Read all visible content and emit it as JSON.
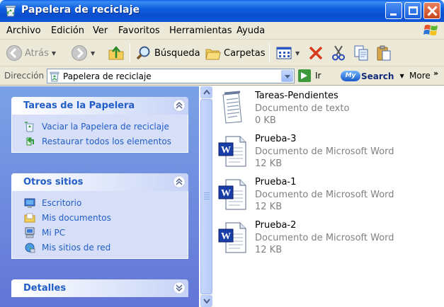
{
  "window": {
    "title": "Papelera de reciclaje",
    "title_icon": "recycle-bin-icon"
  },
  "menu": {
    "items": [
      "Archivo",
      "Edición",
      "Ver",
      "Favoritos",
      "Herramientas",
      "Ayuda"
    ]
  },
  "toolbar": {
    "back_label": "Atrás",
    "search_label": "Búsqueda",
    "folders_label": "Carpetas"
  },
  "address": {
    "label": "Dirección",
    "value": "Papelera de reciclaje",
    "go_label": "Ir",
    "mysearch_logo": "My",
    "mysearch_label": "Search",
    "more_label": "More",
    "more_chevron": "»"
  },
  "taskpane": {
    "panels": [
      {
        "title": "Tareas de la Papelera",
        "expanded": true,
        "items": [
          {
            "label": "Vaciar la Papelera de reciclaje",
            "icon": "empty-recycle-bin-icon"
          },
          {
            "label": "Restaurar todos los elementos",
            "icon": "restore-icon"
          }
        ]
      },
      {
        "title": "Otros sitios",
        "expanded": true,
        "items": [
          {
            "label": "Escritorio",
            "icon": "desktop-icon"
          },
          {
            "label": "Mis documentos",
            "icon": "my-documents-icon"
          },
          {
            "label": "Mi PC",
            "icon": "my-computer-icon"
          },
          {
            "label": "Mis sitios de red",
            "icon": "network-places-icon"
          }
        ]
      },
      {
        "title": "Detalles",
        "expanded": false,
        "items": []
      }
    ]
  },
  "files": [
    {
      "name": "Tareas-Pendientes",
      "type": "Documento de texto",
      "size": "0 KB",
      "icon": "text-document-icon"
    },
    {
      "name": "Prueba-3",
      "type": "Documento de Microsoft Word",
      "size": "12 KB",
      "icon": "word-document-icon"
    },
    {
      "name": "Prueba-1",
      "type": "Documento de Microsoft Word",
      "size": "12 KB",
      "icon": "word-document-icon"
    },
    {
      "name": "Prueba-2",
      "type": "Documento de Microsoft Word",
      "size": "12 KB",
      "icon": "word-document-icon"
    }
  ],
  "colors": {
    "titlebar": "#0a55d8",
    "taskpane_bg": "#7ba2e7",
    "panel_title": "#215dc6",
    "panel_body": "#d6dff7",
    "file_meta": "#808080"
  }
}
